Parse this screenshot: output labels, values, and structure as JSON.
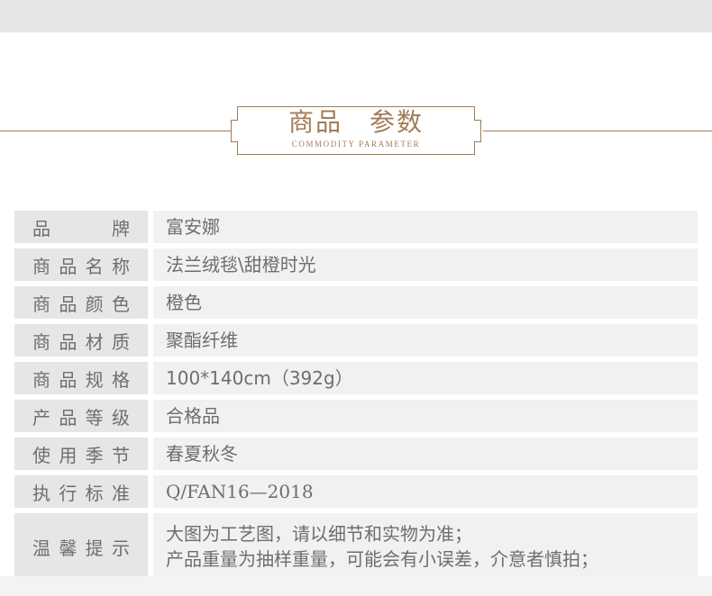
{
  "heading": {
    "title_left": "商品",
    "title_right": "参数",
    "subtitle": "COMMODITY PARAMETER"
  },
  "colors": {
    "accent": "#a07d55",
    "label_bg": "#e6e6e6",
    "value_bg": "#f1f1f1",
    "text": "#6e6e6e"
  },
  "params": [
    {
      "label": [
        "品",
        "牌"
      ],
      "value": [
        "富安娜"
      ]
    },
    {
      "label": [
        "商",
        "品",
        "名",
        "称"
      ],
      "value": [
        "法兰绒毯\\甜橙时光"
      ]
    },
    {
      "label": [
        "商",
        "品",
        "颜",
        "色"
      ],
      "value": [
        "橙色"
      ]
    },
    {
      "label": [
        "商",
        "品",
        "材",
        "质"
      ],
      "value": [
        "聚酯纤维"
      ]
    },
    {
      "label": [
        "商",
        "品",
        "规",
        "格"
      ],
      "value": [
        "100*140cm（392g）"
      ]
    },
    {
      "label": [
        "产",
        "品",
        "等",
        "级"
      ],
      "value": [
        "合格品"
      ]
    },
    {
      "label": [
        "使",
        "用",
        "季",
        "节"
      ],
      "value": [
        "春夏秋冬"
      ]
    },
    {
      "label": [
        "执",
        "行",
        "标",
        "准"
      ],
      "value": [
        "Q/FAN16—2018"
      ]
    },
    {
      "label": [
        "温",
        "馨",
        "提",
        "示"
      ],
      "value": [
        "大图为工艺图，请以细节和实物为准；",
        "产品重量为抽样重量，可能会有小误差，介意者慎拍；"
      ]
    }
  ]
}
